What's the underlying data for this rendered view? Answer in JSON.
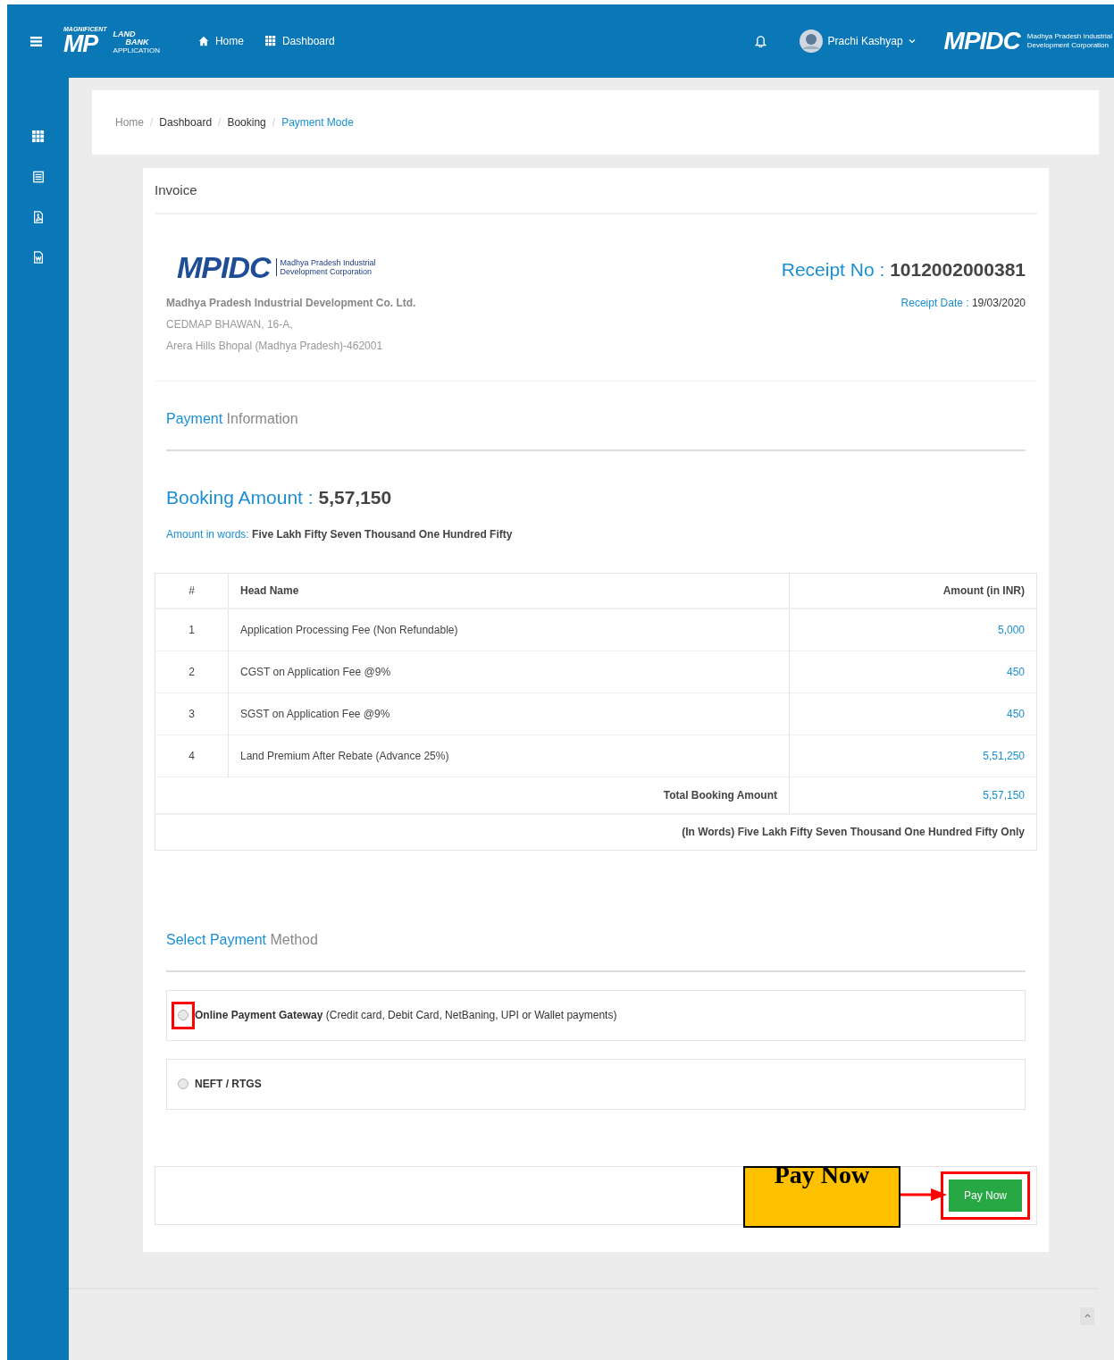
{
  "header": {
    "logo": {
      "top": "MAGNIFICENT",
      "big": "MP",
      "line1": "LAND",
      "line2": "BANK",
      "line3": "APPLICATION"
    },
    "nav": [
      {
        "label": "Home",
        "kind": "home"
      },
      {
        "label": "Dashboard",
        "kind": "grid"
      }
    ],
    "user": "Prachi Kashyap",
    "brand": {
      "mark": "MPIDC",
      "line1": "Madhya Pradesh Industrial",
      "line2": "Development Corporation"
    }
  },
  "sidebar": {
    "items": [
      {
        "kind": "grid"
      },
      {
        "kind": "list"
      },
      {
        "kind": "pdf"
      },
      {
        "kind": "word"
      }
    ]
  },
  "breadcrumb_separator": "/",
  "breadcrumb": [
    {
      "label": "Home",
      "selected": false
    },
    {
      "label": "Dashboard",
      "selected": false
    },
    {
      "label": "Booking",
      "selected": false
    },
    {
      "label": "Payment Mode",
      "selected": true
    }
  ],
  "invoice": {
    "title": "Invoice",
    "company": {
      "mark": "MPIDC",
      "tag1": "Madhya Pradesh Industrial",
      "tag2": "Development Corporation",
      "name": "Madhya Pradesh Industrial Development Co. Ltd.",
      "address": [
        "CEDMAP BHAWAN, 16-A,",
        "Arera Hills Bhopal (Madhya Pradesh)-462001"
      ]
    },
    "receipt": {
      "no_label": "Receipt No :",
      "no": "1012002000381",
      "date_label": "Receipt Date :",
      "date": "19/03/2020"
    },
    "payment_info": {
      "title_accent": "Payment",
      "title_rest": "Information"
    },
    "booking": {
      "label": "Booking Amount :",
      "amount": "5,57,150",
      "words_label": "Amount in words:",
      "words": "Five Lakh Fifty Seven Thousand One Hundred Fifty"
    },
    "table": {
      "columns": [
        "#",
        "Head Name",
        "Amount (in INR)"
      ],
      "rows": [
        {
          "no": "1",
          "head": "Application Processing Fee (Non Refundable)",
          "amount": "5,000"
        },
        {
          "no": "2",
          "head": "CGST on Application Fee @9%",
          "amount": "450"
        },
        {
          "no": "3",
          "head": "SGST on Application Fee @9%",
          "amount": "450"
        },
        {
          "no": "4",
          "head": "Land Premium After Rebate (Advance 25%)",
          "amount": "5,51,250"
        }
      ],
      "total_label": "Total Booking Amount",
      "total": "5,57,150",
      "total_words": "(In Words) Five Lakh Fifty Seven Thousand One Hundred Fifty Only"
    },
    "method": {
      "title_accent": "Select Payment",
      "title_rest": "Method",
      "options": [
        {
          "label": "Online Payment Gateway",
          "detail": "(Credit card, Debit Card, NetBaning, UPI or Wallet payments)",
          "selected": false,
          "highlighted": true
        },
        {
          "label": "NEFT / RTGS",
          "selected": false,
          "highlighted": false
        }
      ]
    },
    "pay_button": {
      "label": "Pay Now",
      "highlighted": true
    },
    "callout": {
      "text": "Pay Now"
    }
  }
}
